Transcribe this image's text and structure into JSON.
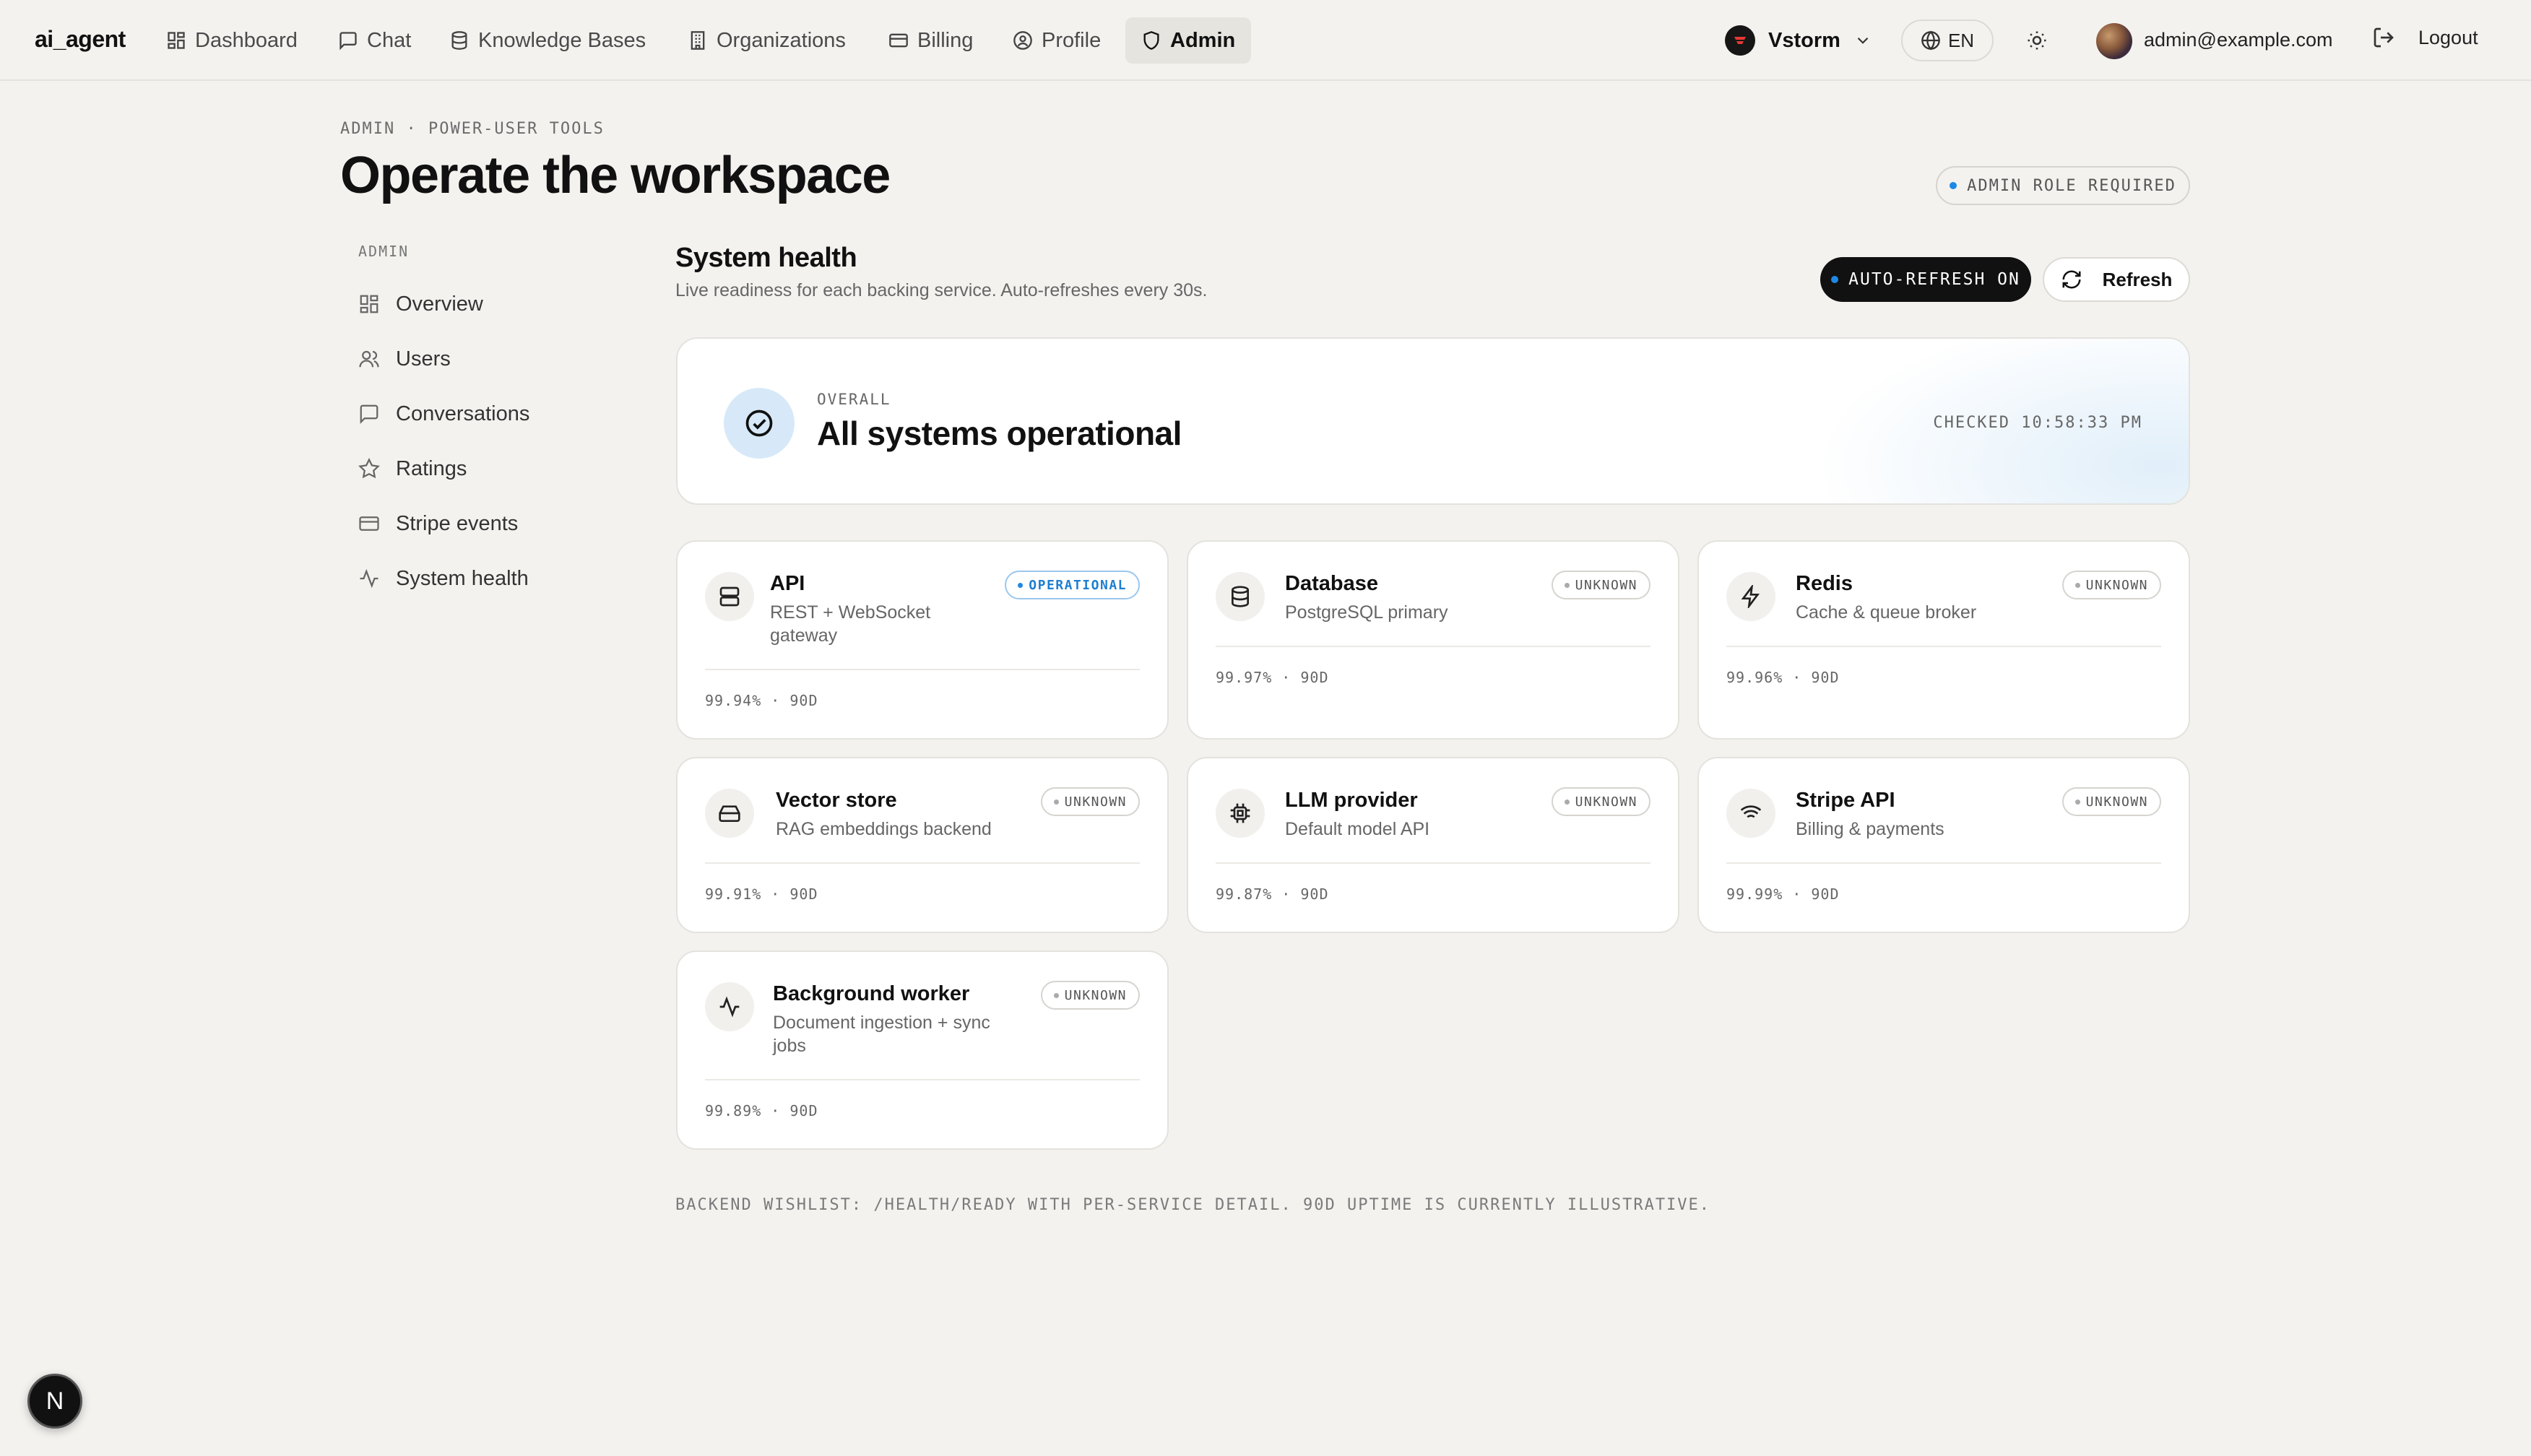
{
  "app": {
    "brand": "ai_agent"
  },
  "nav": {
    "items": [
      {
        "label": "Dashboard",
        "icon": "dashboard-icon"
      },
      {
        "label": "Chat",
        "icon": "chat-icon"
      },
      {
        "label": "Knowledge Bases",
        "icon": "database-icon"
      },
      {
        "label": "Organizations",
        "icon": "building-icon"
      },
      {
        "label": "Billing",
        "icon": "credit-card-icon"
      },
      {
        "label": "Profile",
        "icon": "user-circle-icon"
      },
      {
        "label": "Admin",
        "icon": "shield-icon",
        "active": true
      }
    ],
    "workspace": "Vstorm",
    "language": "EN",
    "user_email": "admin@example.com",
    "logout_label": "Logout"
  },
  "header": {
    "eyebrow": "ADMIN · POWER-USER TOOLS",
    "title": "Operate the workspace",
    "role_badge": "ADMIN ROLE REQUIRED"
  },
  "sidebar": {
    "label": "ADMIN",
    "items": [
      {
        "label": "Overview",
        "icon": "grid-icon"
      },
      {
        "label": "Users",
        "icon": "users-icon"
      },
      {
        "label": "Conversations",
        "icon": "chat-icon"
      },
      {
        "label": "Ratings",
        "icon": "star-icon"
      },
      {
        "label": "Stripe events",
        "icon": "credit-card-icon"
      },
      {
        "label": "System health",
        "icon": "activity-icon"
      }
    ]
  },
  "health": {
    "title": "System health",
    "subtitle": "Live readiness for each backing service. Auto-refreshes every 30s.",
    "auto_refresh": "AUTO-REFRESH ON",
    "refresh_label": "Refresh",
    "overall": {
      "label": "OVERALL",
      "status": "All systems operational",
      "checked": "CHECKED 10:58:33 PM"
    },
    "services": [
      {
        "name": "API",
        "desc": "REST + WebSocket gateway",
        "status": "OPERATIONAL",
        "uptime": "99.94% · 90D",
        "icon": "server-icon"
      },
      {
        "name": "Database",
        "desc": "PostgreSQL primary",
        "status": "UNKNOWN",
        "uptime": "99.97% · 90D",
        "icon": "database-icon"
      },
      {
        "name": "Redis",
        "desc": "Cache & queue broker",
        "status": "UNKNOWN",
        "uptime": "99.96% · 90D",
        "icon": "bolt-icon"
      },
      {
        "name": "Vector store",
        "desc": "RAG embeddings backend",
        "status": "UNKNOWN",
        "uptime": "99.91% · 90D",
        "icon": "hard-drive-icon"
      },
      {
        "name": "LLM provider",
        "desc": "Default model API",
        "status": "UNKNOWN",
        "uptime": "99.87% · 90D",
        "icon": "cpu-icon"
      },
      {
        "name": "Stripe API",
        "desc": "Billing & payments",
        "status": "UNKNOWN",
        "uptime": "99.99% · 90D",
        "icon": "wifi-icon"
      },
      {
        "name": "Background worker",
        "desc": "Document ingestion + sync jobs",
        "status": "UNKNOWN",
        "uptime": "99.89% · 90D",
        "icon": "activity-icon"
      }
    ],
    "footnote": "BACKEND WISHLIST: /HEALTH/READY WITH PER-SERVICE DETAIL. 90D UPTIME IS CURRENTLY ILLUSTRATIVE."
  },
  "floating": {
    "label": "N"
  },
  "colors": {
    "accent": "#1e88e5",
    "background": "#f3f2ef",
    "ink": "#111111"
  }
}
